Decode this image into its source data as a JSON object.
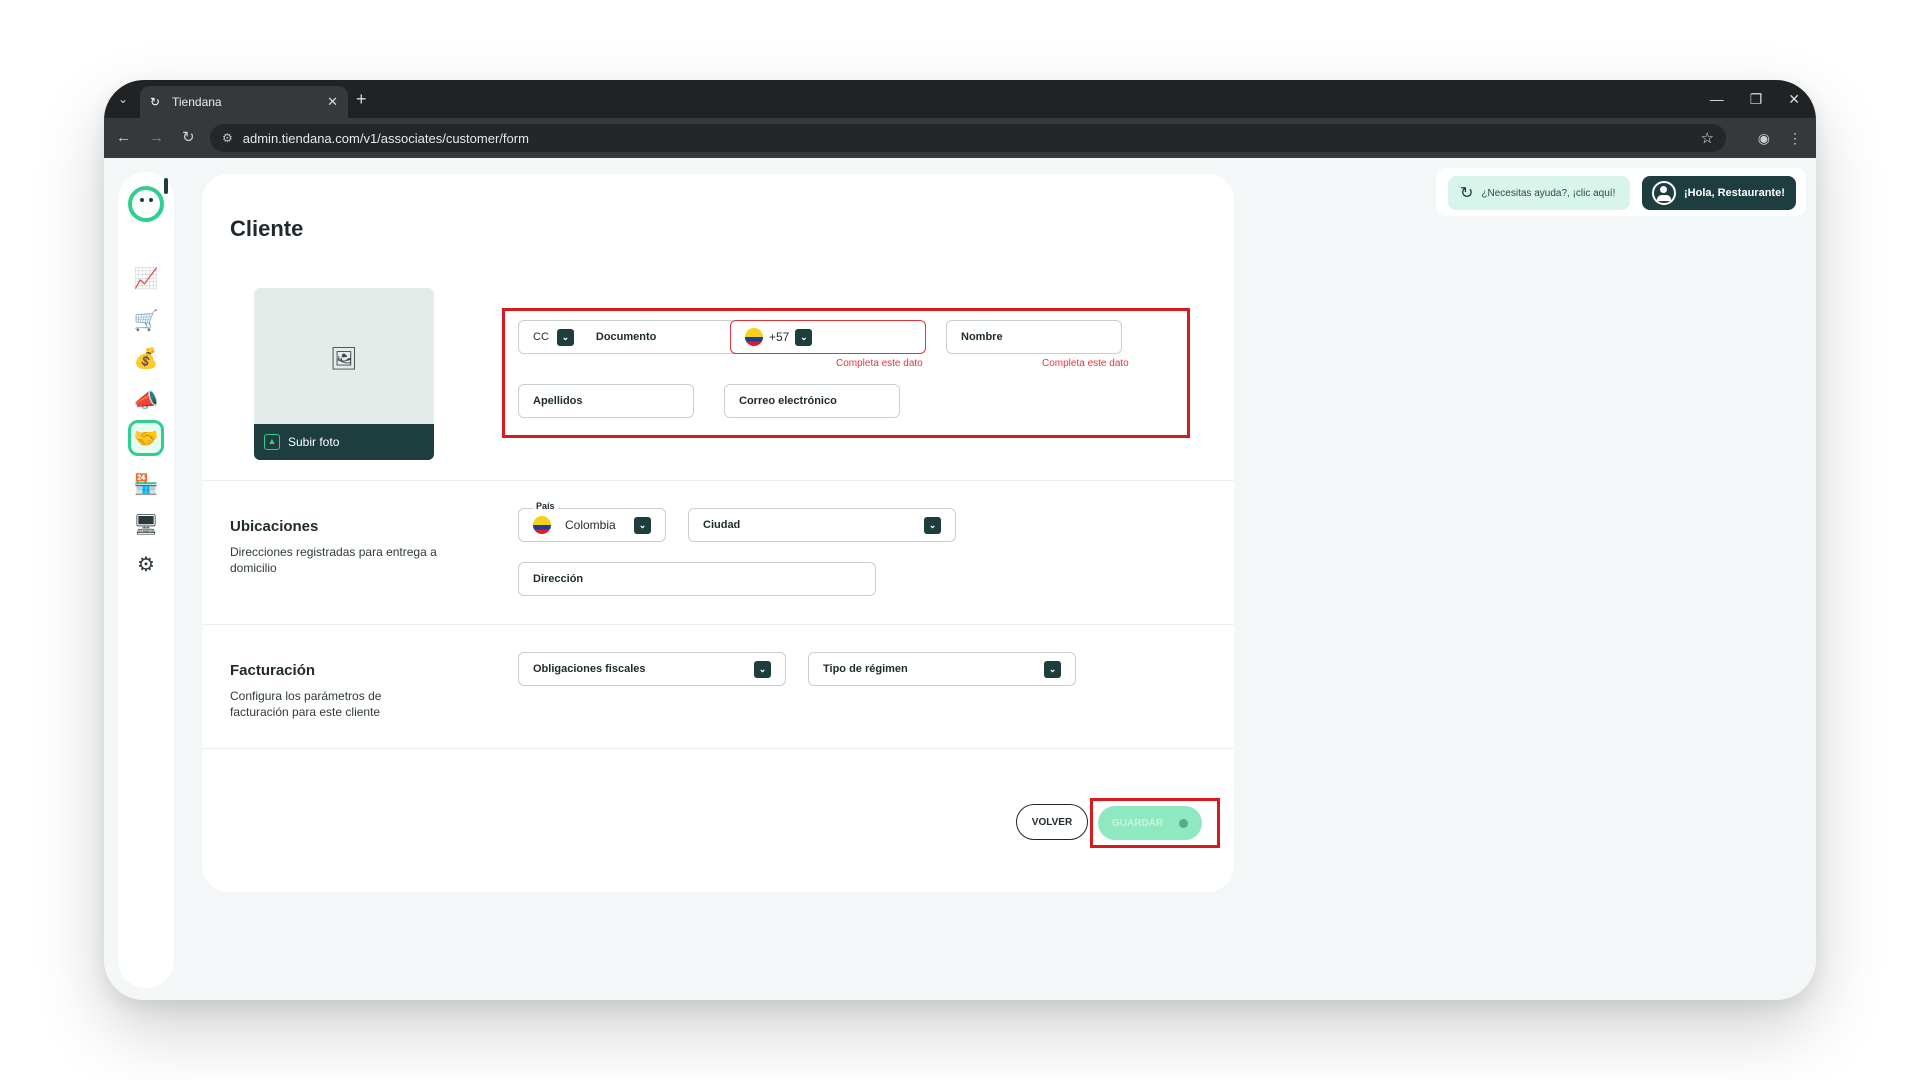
{
  "browser": {
    "tab_title": "Tiendana",
    "tab_close": "✕",
    "new_tab": "+",
    "url": "admin.tiendana.com/v1/associates/customer/form",
    "window_controls": [
      "—",
      "❐",
      "✕"
    ]
  },
  "topbar": {
    "help_label": "¿Necesitas ayuda?, ¡clic aquí!",
    "user_label": "¡Hola, Restaurante!"
  },
  "sidebar": {
    "items": [
      {
        "name": "dashboard-chart-icon",
        "glyph": "📈"
      },
      {
        "name": "cart-icon",
        "glyph": "🛒"
      },
      {
        "name": "money-hand-icon",
        "glyph": "💰"
      },
      {
        "name": "megaphone-icon",
        "glyph": "📣"
      },
      {
        "name": "customers-handshake-icon",
        "glyph": "🤝",
        "active": true
      },
      {
        "name": "store-settings-icon",
        "glyph": "🏪"
      },
      {
        "name": "monitor-icon",
        "glyph": "🖥"
      },
      {
        "name": "gear-icon",
        "glyph": "⚙"
      }
    ]
  },
  "form": {
    "title": "Cliente",
    "upload_label": "Subir foto",
    "doc_type": "CC",
    "doc_placeholder": "Documento",
    "phone_prefix": "+57",
    "name_placeholder": "Nombre",
    "error_text": "Completa este dato",
    "lastname_placeholder": "Apellidos",
    "email_placeholder": "Correo electrónico"
  },
  "locations": {
    "title": "Ubicaciones",
    "description": "Direcciones registradas para entrega a domicilio",
    "country_label": "País",
    "country_value": "Colombia",
    "city_placeholder": "Ciudad",
    "address_placeholder": "Dirección"
  },
  "billing": {
    "title": "Facturación",
    "description": "Configura los parámetros de facturación para este cliente",
    "tax_placeholder": "Obligaciones fiscales",
    "regime_placeholder": "Tipo de régimen"
  },
  "actions": {
    "back_label": "VOLVER",
    "save_label": "GUARDAR"
  },
  "colors": {
    "brand_dark": "#1d3d3e",
    "brand_green": "#2fcf8f",
    "error_red": "#e5343b",
    "highlight_red": "#d71920"
  }
}
